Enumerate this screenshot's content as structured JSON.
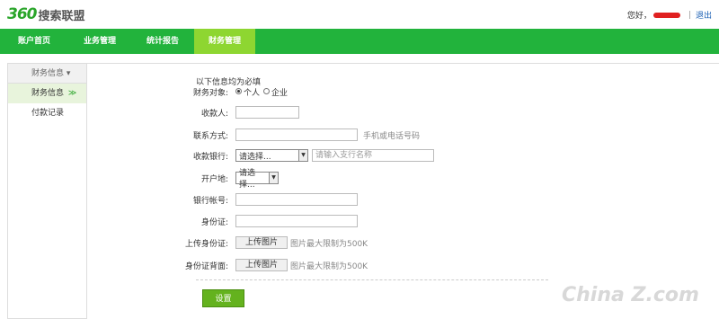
{
  "header": {
    "logo_num": "360",
    "logo_text": "搜索联盟",
    "greeting": "您好，",
    "separator": "|",
    "logout": "退出"
  },
  "nav": {
    "items": [
      "账户首页",
      "业务管理",
      "统计报告",
      "财务管理"
    ],
    "active": "财务管理"
  },
  "sidebar": {
    "head": "财务信息 ▾",
    "items": [
      {
        "label": "财务信息",
        "arrow": "≫"
      },
      {
        "label": "付款记录"
      }
    ]
  },
  "form": {
    "title": "以下信息均为必填",
    "type_label": "财务对象:",
    "type_options": [
      "个人",
      "企业"
    ],
    "payee_label": "收款人:",
    "contact_label": "联系方式:",
    "contact_hint": "手机或电话号码",
    "bank_label": "收款银行:",
    "bank_select": "请选择...",
    "branch_placeholder": "请输入支行名称",
    "region_label": "开户地:",
    "region_select": "请选择...",
    "account_label": "银行帐号:",
    "id_label": "身份证:",
    "upload_id_label": "上传身份证:",
    "upload_back_label": "身份证背面:",
    "upload_button": "上传图片",
    "upload_hint": "图片最大限制为500K",
    "submit": "设置"
  },
  "watermark": "China Z.com"
}
